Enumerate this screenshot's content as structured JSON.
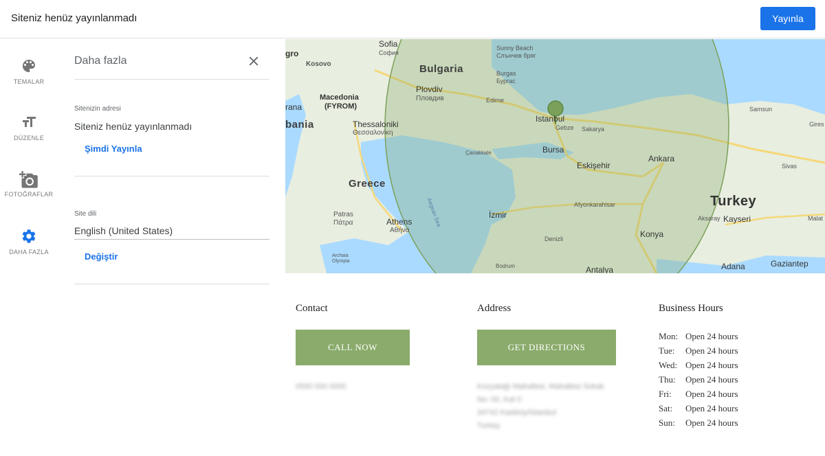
{
  "topbar": {
    "title": "Siteniz henüz yayınlanmadı",
    "publish_label": "Yayınla"
  },
  "rail": {
    "items": [
      {
        "label": "TEMALAR",
        "icon": "palette-icon"
      },
      {
        "label": "DÜZENLE",
        "icon": "text-size-icon"
      },
      {
        "label": "FOTOĞRAFLAR",
        "icon": "add-photo-icon"
      },
      {
        "label": "DAHA FAZLA",
        "icon": "gear-icon",
        "active": true
      }
    ]
  },
  "panel": {
    "title": "Daha fazla",
    "site_address": {
      "caption": "Sitenizin adresi",
      "value": "Siteniz henüz yayınlanmadı",
      "link": "Şimdi Yayınla"
    },
    "site_language": {
      "caption": "Site dili",
      "value": "English (United States)",
      "link": "Değiştir"
    }
  },
  "map": {
    "labels": {
      "sofia": "Sofia",
      "sofia_cyr": "София",
      "kosovo": "Kosovo",
      "gro": "gro",
      "bulgaria": "Bulgaria",
      "plovdiv": "Plovdiv",
      "plovdiv_cyr": "Пловдив",
      "sunny_beach": "Sunny Beach",
      "sunny_beach_cyr": "Слънчев бряг",
      "burgas": "Burgas",
      "burgas_cyr": "Бургас",
      "edirne": "Edirne",
      "macedonia": "Macedonia",
      "fyrom": "(FYROM)",
      "rana": "rana",
      "bania": "bania",
      "thessaloniki": "Thessaloniki",
      "thessaloniki_gr": "Θεσσαλονίκη",
      "istanbul": "Istanbul",
      "gebze": "Gebze",
      "sakarya": "Sakarya",
      "samsun": "Samsun",
      "gires": "Gires",
      "canakkale": "Çanakkale",
      "bursa": "Bursa",
      "eskisehir": "Eskişehir",
      "ankara": "Ankara",
      "sivas": "Sivas",
      "greece": "Greece",
      "aegean_sea": "Aegean Sea",
      "turkey": "Turkey",
      "aksaray": "Aksaray",
      "kayseri": "Kayseri",
      "malatya": "Malat",
      "afyonkarahisar": "Afyonkarahisar",
      "patras": "Patras",
      "patras_gr": "Πάτρα",
      "athens": "Athens",
      "athens_gr": "Αθήνα",
      "izmir": "İzmir",
      "denizli": "Denizli",
      "konya": "Konya",
      "arcaia": "Archaia",
      "olympia": "Olympia",
      "bodrum": "Bodrum",
      "antalya": "Antalya",
      "adana": "Adana",
      "gaziantep": "Gaziantep"
    }
  },
  "contact": {
    "heading": "Contact",
    "button": "CALL NOW",
    "phone": "0500 000 0000"
  },
  "address": {
    "heading": "Address",
    "button": "GET DIRECTIONS",
    "lines": [
      "Kozyatağı Mahallesi, Mahallesi Sokak",
      "No: 00, Kat 0",
      "34742 Kadıköy/İstanbul",
      "Turkey"
    ]
  },
  "hours": {
    "heading": "Business Hours",
    "rows": [
      {
        "day": "Mon:",
        "value": "Open 24 hours"
      },
      {
        "day": "Tue:",
        "value": "Open 24 hours"
      },
      {
        "day": "Wed:",
        "value": "Open 24 hours"
      },
      {
        "day": "Thu:",
        "value": "Open 24 hours"
      },
      {
        "day": "Fri:",
        "value": "Open 24 hours"
      },
      {
        "day": "Sat:",
        "value": "Open 24 hours"
      },
      {
        "day": "Sun:",
        "value": "Open 24 hours"
      }
    ]
  },
  "colors": {
    "accent_blue": "#1a73e8",
    "button_green": "#8aab6b",
    "map_water": "#aadaff",
    "map_land": "#e8eee0",
    "radius_fill": "#8aab6b"
  }
}
